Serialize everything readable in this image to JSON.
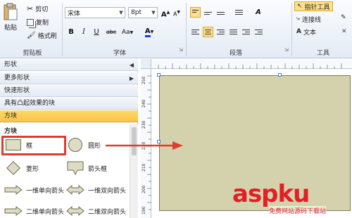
{
  "ribbon": {
    "clipboard": {
      "paste_label": "粘贴",
      "cut_label": "剪切",
      "copy_label": "复制",
      "format_painter_label": "格式刷",
      "group_label": "剪贴板"
    },
    "font": {
      "font_name": "宋体",
      "font_size": "8pt",
      "bold": "B",
      "italic": "I",
      "underline": "U",
      "strikethrough": "abc",
      "change_case": "Aa",
      "font_color_glyph": "A",
      "grow_glyph": "A",
      "shrink_glyph": "A",
      "group_label": "字体"
    },
    "paragraph": {
      "group_label": "段落"
    },
    "tools": {
      "pointer_label": "指针工具",
      "connector_label": "连接线",
      "text_label": "文本",
      "group_label": "工具"
    }
  },
  "shapes_panel": {
    "title": "形状",
    "rows": [
      "更多形状",
      "快速形状",
      "具有凸起效果的块",
      "方块"
    ],
    "stencil_title": "方块",
    "masters": [
      {
        "label": "框",
        "icon": "rectangle-icon"
      },
      {
        "label": "圆形",
        "icon": "circle-icon"
      },
      {
        "label": "菱形",
        "icon": "diamond-icon"
      },
      {
        "label": "箭头框",
        "icon": "callout-box-icon"
      },
      {
        "label": "一维单向箭头",
        "icon": "one-way-arrow-icon"
      },
      {
        "label": "一维双向箭头",
        "icon": "two-way-arrow-icon"
      },
      {
        "label": "二维单向箭头",
        "icon": "2d-one-way-arrow-icon"
      },
      {
        "label": "二维双向箭头",
        "icon": "2d-two-way-arrow-icon"
      }
    ]
  },
  "rulers": {
    "left_ticks": [
      "250",
      "240",
      "230",
      "220",
      "210",
      "200",
      "190"
    ]
  },
  "watermark": {
    "main": "aspku",
    "sub": "免费网站源码下载站"
  },
  "colors": {
    "shape_fill": "#d3d2ad",
    "selection_red": "#e23a2e",
    "highlight": "#fde08a"
  }
}
